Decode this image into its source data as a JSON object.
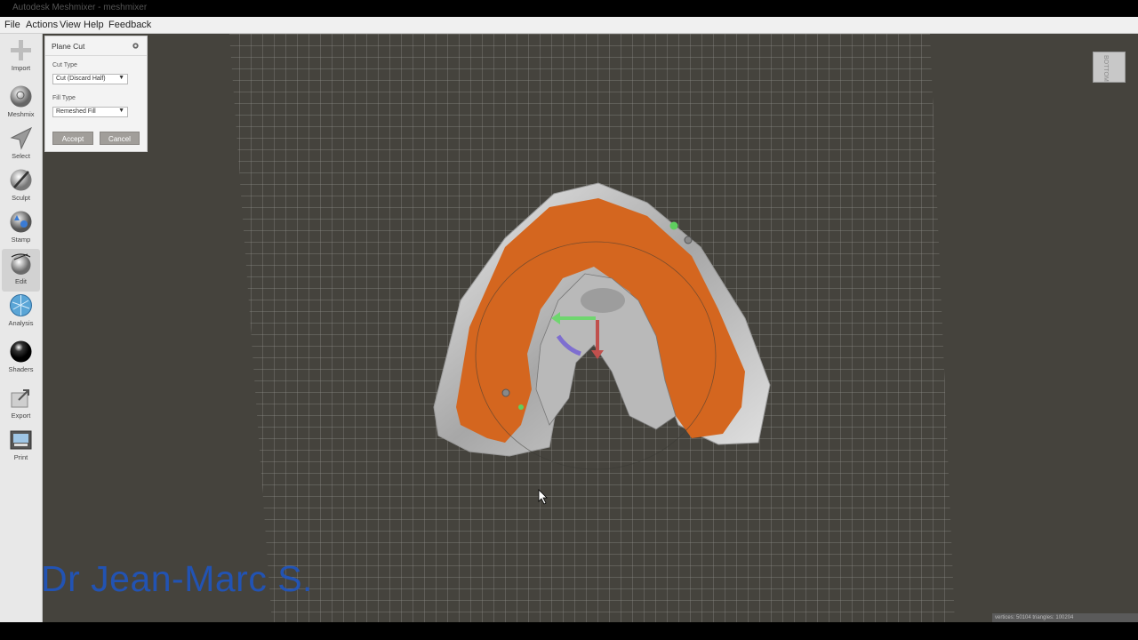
{
  "window": {
    "title": "Autodesk Meshmixer - meshmixer"
  },
  "menu": {
    "items": [
      "File",
      "Actions",
      "View",
      "Help",
      "Feedback"
    ]
  },
  "sidebar": {
    "tools": [
      {
        "label": "Import",
        "icon": "plus-icon"
      },
      {
        "label": "Meshmix",
        "icon": "meshmix-sphere-icon"
      },
      {
        "label": "Select",
        "icon": "select-arrow-icon"
      },
      {
        "label": "Sculpt",
        "icon": "sculpt-brush-icon"
      },
      {
        "label": "Stamp",
        "icon": "stamp-icon"
      },
      {
        "label": "Edit",
        "icon": "edit-sphere-icon",
        "active": true
      },
      {
        "label": "Analysis",
        "icon": "analysis-icon"
      },
      {
        "label": "Shaders",
        "icon": "shader-sphere-icon"
      },
      {
        "label": "Export",
        "icon": "export-icon"
      },
      {
        "label": "Print",
        "icon": "printer-icon"
      }
    ]
  },
  "panel": {
    "title": "Plane Cut",
    "cut_type_label": "Cut Type",
    "cut_type_value": "Cut (Discard Half)",
    "fill_type_label": "Fill Type",
    "fill_type_value": "Remeshed Fill",
    "accept_label": "Accept",
    "cancel_label": "Cancel"
  },
  "viewcube": {
    "face": "BOTTOM"
  },
  "status": {
    "text": "vertices: 50104  triangles: 100204"
  },
  "watermark": {
    "text": "Dr Jean-Marc S."
  },
  "colors": {
    "background": "#45433d",
    "grid": "#8a8a86",
    "selection": "#d4661f",
    "mesh": "#cfcfcf"
  }
}
